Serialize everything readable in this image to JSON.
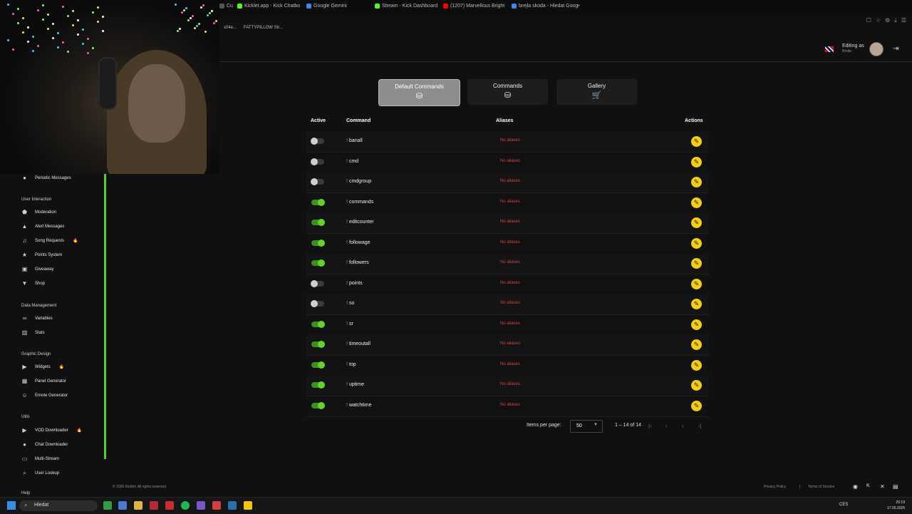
{
  "browser": {
    "tabs": [
      {
        "label": "Cu",
        "color": "#555555"
      },
      {
        "label": "Kicklet.app - Kick Chatbo",
        "color": "#53fc18"
      },
      {
        "label": "Google Gemini",
        "color": "#4285f4"
      },
      {
        "label": "Stream - Kick Dashboard",
        "color": "#53fc18"
      },
      {
        "label": "(1207) Marvellous Bright",
        "color": "#ff0000"
      },
      {
        "label": "brejla skoda - Hledat Goog",
        "color": "#4285f4"
      }
    ],
    "new_tab": "+",
    "bookmarks": [
      {
        "label": "s04e..."
      },
      {
        "label": "FATTYPILLOW Str..."
      }
    ]
  },
  "header": {
    "editing_as": "Editing as",
    "user": "Brejla",
    "language_flag": "uk-flag",
    "logout_icon": "logout-icon"
  },
  "sidebar": {
    "top_item": {
      "label": "Periodic Messages",
      "icon": "chat-icon"
    },
    "sections": [
      {
        "title": "User Interaction",
        "items": [
          {
            "label": "Moderation",
            "icon": "shield-icon",
            "fire": false
          },
          {
            "label": "Alert Messages",
            "icon": "warning-icon",
            "fire": false
          },
          {
            "label": "Song Requests",
            "icon": "music-icon",
            "fire": true
          },
          {
            "label": "Points System",
            "icon": "star-icon",
            "fire": false
          },
          {
            "label": "Giveaway",
            "icon": "gift-icon",
            "fire": false
          },
          {
            "label": "Shop",
            "icon": "cart-icon",
            "fire": false
          }
        ]
      },
      {
        "title": "Data Management",
        "items": [
          {
            "label": "Variables",
            "icon": "link-icon",
            "fire": false
          },
          {
            "label": "Stats",
            "icon": "chart-icon",
            "fire": false
          }
        ]
      },
      {
        "title": "Graphic Design",
        "items": [
          {
            "label": "Widgets",
            "icon": "video-icon",
            "fire": true
          },
          {
            "label": "Panel Generator",
            "icon": "panel-icon",
            "fire": false
          },
          {
            "label": "Emote Generator",
            "icon": "emote-icon",
            "fire": false
          }
        ]
      },
      {
        "title": "Utils",
        "items": [
          {
            "label": "VOD Downloader",
            "icon": "video-icon",
            "fire": true
          },
          {
            "label": "Chat Downloader",
            "icon": "chat-icon",
            "fire": false
          },
          {
            "label": "Multi-Stream",
            "icon": "screen-icon",
            "fire": false
          },
          {
            "label": "User Lookup",
            "icon": "search-icon",
            "fire": false
          }
        ]
      }
    ],
    "help": "Help"
  },
  "main_tabs": [
    {
      "label": "Default Commands",
      "icon": "database-icon",
      "active": true
    },
    {
      "label": "Commands",
      "icon": "database-icon",
      "active": false
    },
    {
      "label": "Gallery",
      "icon": "cart-icon",
      "active": false
    }
  ],
  "table": {
    "headers": {
      "active": "Active",
      "command": "Command",
      "aliases": "Aliases",
      "actions": "Actions"
    },
    "rows": [
      {
        "command": "banall",
        "active": false,
        "aliases": "No aliases"
      },
      {
        "command": "cmd",
        "active": false,
        "aliases": "No aliases"
      },
      {
        "command": "cmdgroup",
        "active": false,
        "aliases": "No aliases"
      },
      {
        "command": "commands",
        "active": true,
        "aliases": "No aliases"
      },
      {
        "command": "editcounter",
        "active": true,
        "aliases": "No aliases"
      },
      {
        "command": "followage",
        "active": true,
        "aliases": "No aliases"
      },
      {
        "command": "followers",
        "active": true,
        "aliases": "No aliases"
      },
      {
        "command": "points",
        "active": false,
        "aliases": "No aliases"
      },
      {
        "command": "so",
        "active": false,
        "aliases": "No aliases"
      },
      {
        "command": "sr",
        "active": true,
        "aliases": "No aliases"
      },
      {
        "command": "timeoutall",
        "active": true,
        "aliases": "No aliases"
      },
      {
        "command": "top",
        "active": true,
        "aliases": "No aliases"
      },
      {
        "command": "uptime",
        "active": true,
        "aliases": "No aliases"
      },
      {
        "command": "watchtime",
        "active": true,
        "aliases": "No aliases"
      }
    ],
    "prefix": "!"
  },
  "pagination": {
    "items_per_page_label": "Items per page:",
    "items_per_page": "50",
    "range": "1 – 14 of 14"
  },
  "footer": {
    "copyright": "© 2026 Kicklet. All rights reserved.",
    "privacy": "Privacy Policy",
    "separator": "|",
    "terms": "Terms of Service"
  },
  "taskbar": {
    "search_placeholder": "Hledat",
    "time": "20:19",
    "date": "17.05.2026",
    "lang": "CES"
  },
  "colors": {
    "accent_green": "#63d329",
    "edit_yellow": "#f2cf14",
    "alias_red": "#d24545"
  }
}
